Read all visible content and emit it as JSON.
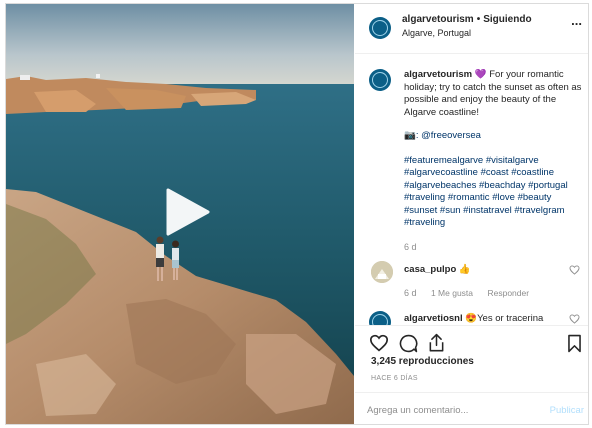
{
  "header": {
    "username": "algarvetourism",
    "separator": "•",
    "follow_status": "Siguiendo",
    "location": "Algarve, Portugal",
    "more_icon": "ellipsis-icon",
    "more_label": "..."
  },
  "caption": {
    "username": "algarvetourism",
    "emoji": "💜",
    "text": "For your romantic holiday; try to catch the sunset as often as possible and enjoy the beauty of the Algarve coastline!",
    "credit_icon": "📷",
    "credit": ": @freeoversea",
    "hashtags": [
      "#featuremealgarve",
      "#visitalgarve",
      "#algarvecoastline",
      "#coast",
      "#coastline",
      "#algarvebeaches",
      "#beachday",
      "#portugal",
      "#traveling",
      "#romantic",
      "#love",
      "#beauty",
      "#sunset",
      "#sun",
      "#instatravel",
      "#travelgram",
      "#traveling"
    ],
    "time": "6 d"
  },
  "comments": [
    {
      "username": "casa_pulpo",
      "text": "👍",
      "time": "6 d",
      "likes": "1 Me gusta",
      "reply": "Responder"
    },
    {
      "username": "algarvetiosnl",
      "text": "😍Yes or tracerina"
    }
  ],
  "stats": {
    "views": "3,245 reproducciones",
    "ago": "HACE 6 DÍAS"
  },
  "composer": {
    "placeholder": "Agrega un comentario...",
    "publish": "Publicar"
  },
  "icons": {
    "like": "heart-icon",
    "comment": "comment-icon",
    "share": "share-icon",
    "save": "bookmark-icon",
    "play": "play-icon"
  }
}
